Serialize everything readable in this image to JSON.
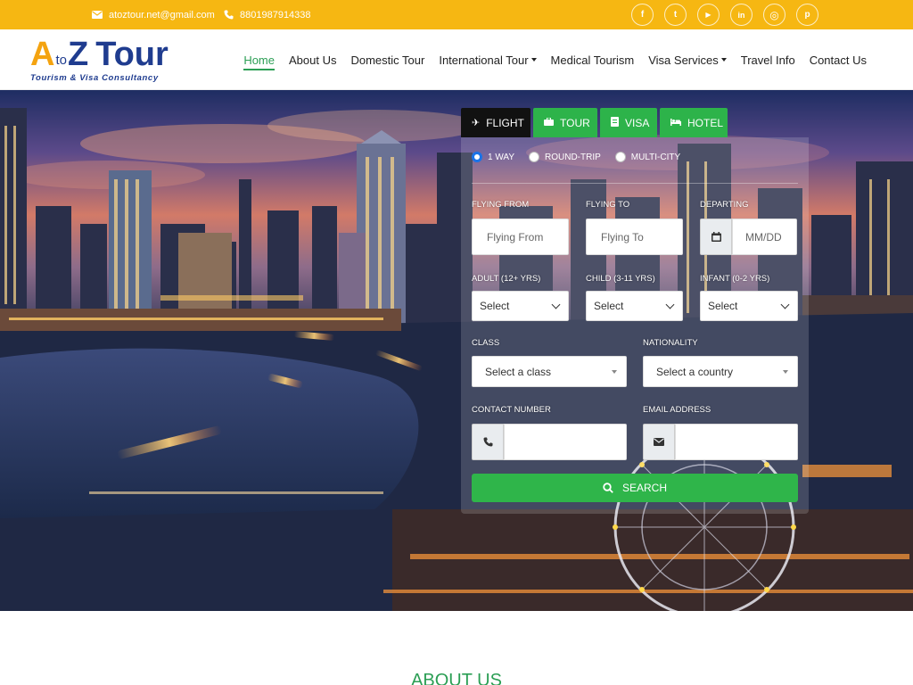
{
  "topbar": {
    "email": "atoztour.net@gmail.com",
    "phone": "8801987914338",
    "socials": [
      {
        "icon": "facebook-icon",
        "glyph": "f"
      },
      {
        "icon": "twitter-icon",
        "glyph": "t"
      },
      {
        "icon": "youtube-icon",
        "glyph": "▶"
      },
      {
        "icon": "linkedin-icon",
        "glyph": "in"
      },
      {
        "icon": "instagram-icon",
        "glyph": "◎"
      },
      {
        "icon": "pinterest-icon",
        "glyph": "p"
      }
    ]
  },
  "logo": {
    "a": "A",
    "to": "to",
    "z": "Z",
    "tour": "Tour",
    "tagline": "Tourism & Visa Consultancy"
  },
  "nav": {
    "items": [
      {
        "label": "Home",
        "active": true,
        "dropdown": false
      },
      {
        "label": "About Us",
        "active": false,
        "dropdown": false
      },
      {
        "label": "Domestic Tour",
        "active": false,
        "dropdown": false
      },
      {
        "label": "International Tour",
        "active": false,
        "dropdown": true
      },
      {
        "label": "Medical Tourism",
        "active": false,
        "dropdown": false
      },
      {
        "label": "Visa Services",
        "active": false,
        "dropdown": true
      },
      {
        "label": "Travel Info",
        "active": false,
        "dropdown": false
      },
      {
        "label": "Contact Us",
        "active": false,
        "dropdown": false
      }
    ]
  },
  "booking": {
    "tabs": {
      "flight": "FLIGHT",
      "tour": "TOUR",
      "visa": "VISA",
      "hotel": "HOTEL"
    },
    "trip_types": {
      "one_way": "1 WAY",
      "round_trip": "ROUND-TRIP",
      "multi_city": "MULTI-CITY"
    },
    "labels": {
      "flying_from": "FLYING FROM",
      "flying_to": "FLYING TO",
      "departing": "DEPARTING",
      "adult": "ADULT (12+ YRS)",
      "child": "CHILD (3-11 YRS)",
      "infant": "INFANT (0-2 YRS)",
      "class": "CLASS",
      "nationality": "NATIONALITY",
      "contact_number": "CONTACT NUMBER",
      "email_address": "EMAIL ADDRESS"
    },
    "placeholders": {
      "flying_from": "Flying From",
      "flying_to": "Flying To",
      "departing": "MM/DD"
    },
    "selects": {
      "adult": "Select",
      "child": "Select",
      "infant": "Select",
      "class": "Select a class",
      "nationality": "Select a country"
    },
    "search": "SEARCH"
  },
  "about": {
    "heading": "ABOUT US"
  },
  "colors": {
    "topbar": "#f6b712",
    "accent_green": "#2db34a",
    "nav_active": "#2b9e54",
    "logo_blue": "#1f3c8f",
    "logo_orange": "#f4a310"
  }
}
